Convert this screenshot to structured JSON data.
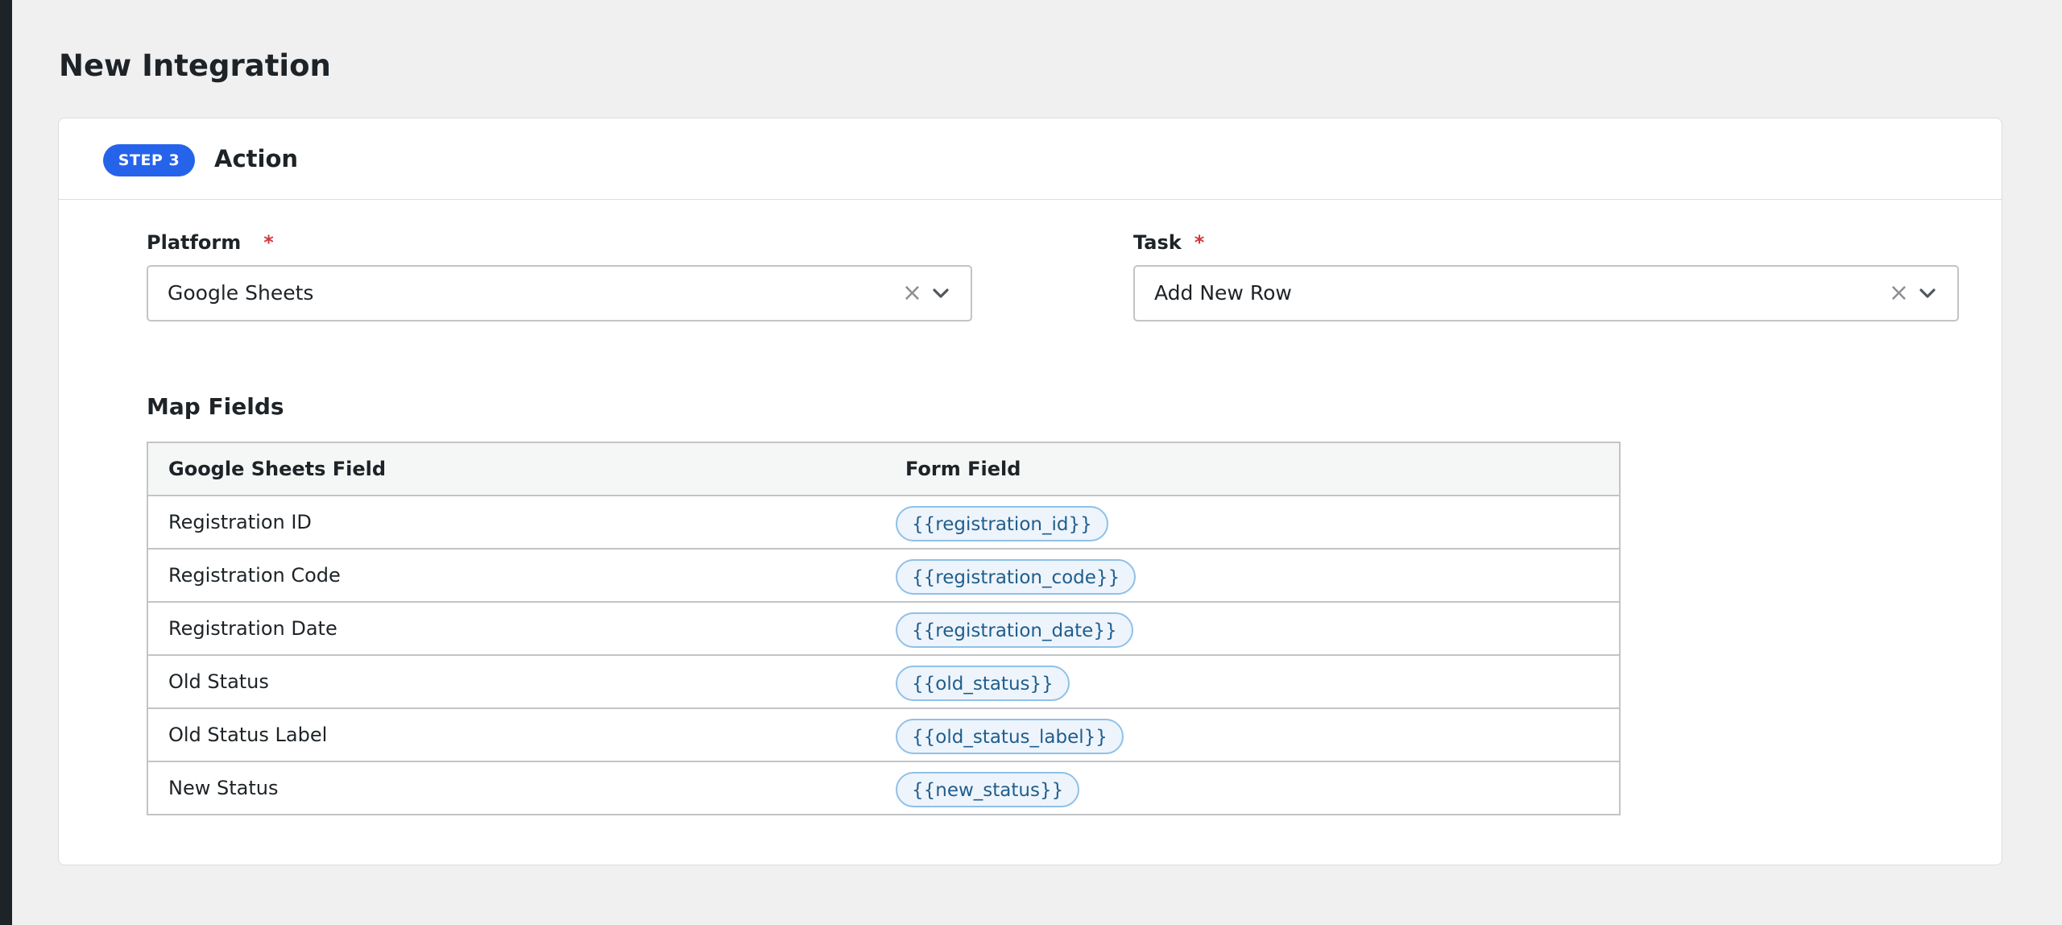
{
  "page": {
    "title": "New Integration"
  },
  "step": {
    "badge": "STEP 3",
    "title": "Action"
  },
  "platform": {
    "label": "Platform",
    "required_marker": "*",
    "value": "Google Sheets",
    "clear_glyph": "×"
  },
  "task": {
    "label": "Task",
    "required_marker": "*",
    "value": "Add New Row",
    "clear_glyph": "×"
  },
  "map_fields": {
    "title": "Map Fields",
    "columns": [
      "Google Sheets Field",
      "Form Field"
    ],
    "rows": [
      {
        "field": "Registration ID",
        "tag": "{{registration_id}}"
      },
      {
        "field": "Registration Code",
        "tag": "{{registration_code}}"
      },
      {
        "field": "Registration Date",
        "tag": "{{registration_date}}"
      },
      {
        "field": "Old Status",
        "tag": "{{old_status}}"
      },
      {
        "field": "Old Status Label",
        "tag": "{{old_status_label}}"
      },
      {
        "field": "New Status",
        "tag": "{{new_status}}"
      }
    ]
  },
  "colors": {
    "accent": "#2563eb",
    "required": "#d63638",
    "tag_background": "#eef4fc",
    "tag_border": "#8fc1e8",
    "tag_text": "#1f5e8c"
  },
  "icons": {
    "clear": "close-icon",
    "dropdown": "chevron-down-icon"
  }
}
